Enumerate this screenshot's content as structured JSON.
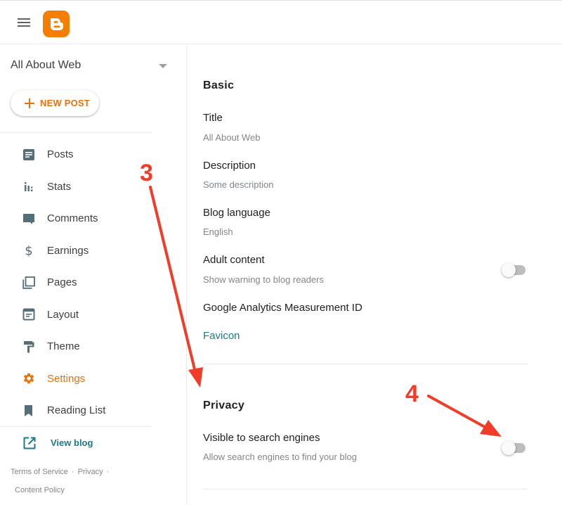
{
  "header": {
    "menu_icon": "hamburger-menu-icon",
    "logo_icon": "blogger-logo",
    "brand_color": "#f57d00"
  },
  "sidebar": {
    "blog_name": "All About Web",
    "new_post_label": "NEW POST",
    "items": [
      {
        "label": "Posts",
        "icon": "posts-icon",
        "active": false
      },
      {
        "label": "Stats",
        "icon": "stats-icon",
        "active": false
      },
      {
        "label": "Comments",
        "icon": "comments-icon",
        "active": false
      },
      {
        "label": "Earnings",
        "icon": "dollar-icon",
        "active": false
      },
      {
        "label": "Pages",
        "icon": "pages-icon",
        "active": false
      },
      {
        "label": "Layout",
        "icon": "layout-icon",
        "active": false
      },
      {
        "label": "Theme",
        "icon": "paint-roller-icon",
        "active": false
      },
      {
        "label": "Settings",
        "icon": "gear-icon",
        "active": true
      },
      {
        "label": "Reading List",
        "icon": "bookmark-icon",
        "active": false
      }
    ],
    "view_blog_label": "View blog",
    "footer": {
      "terms": "Terms of Service",
      "privacy": "Privacy",
      "separator": "·",
      "content_policy": "Content Policy"
    },
    "active_color": "#e8710a",
    "icon_color": "#546e7a"
  },
  "main": {
    "basic": {
      "heading": "Basic",
      "title_label": "Title",
      "title_value": "All About Web",
      "description_label": "Description",
      "description_value": "Some description",
      "language_label": "Blog language",
      "language_value": "English",
      "adult_label": "Adult content",
      "adult_desc": "Show warning to blog readers",
      "adult_enabled": false,
      "analytics_label": "Google Analytics Measurement ID",
      "favicon_label": "Favicon"
    },
    "privacy": {
      "heading": "Privacy",
      "visible_label": "Visible to search engines",
      "visible_desc": "Allow search engines to find your blog",
      "visible_enabled": false
    },
    "link_color": "#1a7a8a"
  },
  "annotations": [
    {
      "number": "3",
      "color": "#f23c2a"
    },
    {
      "number": "4",
      "color": "#f23c2a"
    }
  ]
}
